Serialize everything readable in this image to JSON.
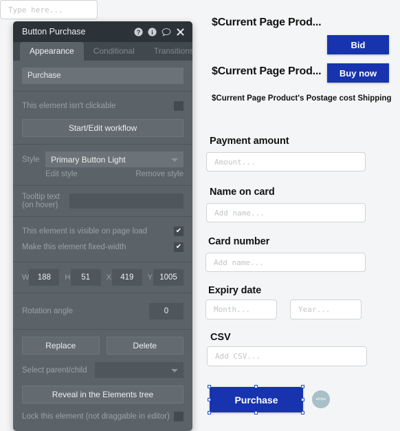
{
  "canvas": {
    "product_line_1": {
      "title": "$Current Page Prod...",
      "input_placeholder": "Type here...",
      "button_label": "Bid"
    },
    "product_line_2": {
      "title": "$Current Page Prod...",
      "button_label": "Buy now"
    },
    "shipping_note": "$Current Page Product's Postage cost Shipping",
    "fields": [
      {
        "label": "Payment amount",
        "placeholder": "Amount..."
      },
      {
        "label": "Name on card",
        "placeholder": "Add name..."
      },
      {
        "label": "Card number",
        "placeholder": "Add name..."
      },
      {
        "label": "Expiry date",
        "placeholder": "Month...",
        "placeholder2": "Year..."
      },
      {
        "label": "CSV",
        "placeholder": "Add CSV..."
      }
    ],
    "purchase_button": "Purchase",
    "stripe_badge": "stripe",
    "accent_blue": "#1733ad"
  },
  "panel": {
    "title": "Button Purchase",
    "header_icons": [
      "help-icon",
      "info-icon",
      "comment-icon",
      "close-icon"
    ],
    "tabs": [
      {
        "label": "Appearance",
        "active": true
      },
      {
        "label": "Conditional",
        "active": false
      },
      {
        "label": "Transitions",
        "active": false
      }
    ],
    "element_text": "Purchase",
    "clickable_row": {
      "label": "This element isn't clickable",
      "checked": false
    },
    "workflow_button": "Start/Edit workflow",
    "style": {
      "label": "Style",
      "value": "Primary Button Light",
      "edit_link": "Edit style",
      "remove_link": "Remove style"
    },
    "tooltip": {
      "label": "Tooltip text (on hover)",
      "value": ""
    },
    "visible_row": {
      "label": "This element is visible on page load",
      "checked": true
    },
    "fixed_width_row": {
      "label": "Make this element fixed-width",
      "checked": true
    },
    "dimensions": {
      "w_label": "W",
      "w": "188",
      "h_label": "H",
      "h": "51",
      "x_label": "X",
      "x": "419",
      "y_label": "Y",
      "y": "1005"
    },
    "rotation": {
      "label": "Rotation angle",
      "value": "0"
    },
    "replace_button": "Replace",
    "delete_button": "Delete",
    "parent_child": {
      "label": "Select parent/child",
      "value": ""
    },
    "reveal_button": "Reveal in the Elements tree",
    "lock_row": {
      "label": "Lock this element (not draggable in editor)",
      "checked": false
    }
  }
}
